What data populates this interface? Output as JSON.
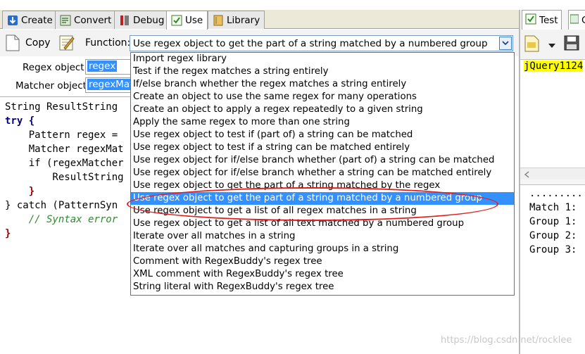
{
  "tabs": [
    {
      "label": "Create",
      "icon": "create-icon",
      "active": false
    },
    {
      "label": "Convert",
      "icon": "convert-icon",
      "active": false
    },
    {
      "label": "Debug",
      "icon": "debug-icon",
      "active": false
    },
    {
      "label": "Use",
      "icon": "use-icon",
      "active": true
    },
    {
      "label": "Library",
      "icon": "library-icon",
      "active": false
    }
  ],
  "toolbar": {
    "copy_label": "Copy",
    "function_label": "Function:",
    "function_value": "Use regex object to get the part of a string matched by a numbered group"
  },
  "fields": {
    "regex_object_label": "Regex object",
    "regex_object_value": "regex",
    "matcher_object_label": "Matcher object",
    "matcher_object_value": "regexMat"
  },
  "code_lines": [
    "String ResultString",
    "try {",
    "    Pattern regex =",
    "    Matcher regexMat",
    "    if (regexMatcher",
    "        ResultString",
    "    }",
    "} catch (PatternSyn",
    "    // Syntax error",
    "}"
  ],
  "dropdown": {
    "selected_index": 11,
    "options": [
      "Import regex library",
      "Test if the regex matches a string entirely",
      "If/else branch whether the regex matches a string entirely",
      "Create an object to use the same regex for many operations",
      "Create an object to apply a regex repeatedly to a given string",
      "Apply the same regex to more than one string",
      "Use regex object to test if (part of) a string can be matched",
      "Use regex object to test if a string can be matched entirely",
      "Use regex object for if/else branch whether (part of) a string can be matched",
      "Use regex object for if/else branch whether a string can be matched entirely",
      "Use regex object to get the part of a string matched by the regex",
      "Use regex object to get the part of a string matched by a numbered group",
      "Use regex object to get a list of all regex matches in a string",
      "Use regex object to get a list of all text matched by a numbered group",
      "Iterate over all matches in a string",
      "Iterate over all matches and capturing groups in a string",
      "Comment with RegexBuddy's regex tree",
      "XML comment with RegexBuddy's regex tree",
      "String literal with RegexBuddy's regex tree"
    ]
  },
  "right_panel": {
    "tab_label": "Test",
    "tab2_label": "G",
    "test_text": "jQuery1124",
    "results": [
      "..........",
      "Match 1:",
      "Group 1:",
      "Group 2:",
      "Group 3:"
    ]
  },
  "watermark": "https://blog.csdn.net/rocklee",
  "colors": {
    "selection": "#3390ff",
    "annotation_ellipse": "#e02020",
    "highlight_yellow": "#ffff00"
  }
}
